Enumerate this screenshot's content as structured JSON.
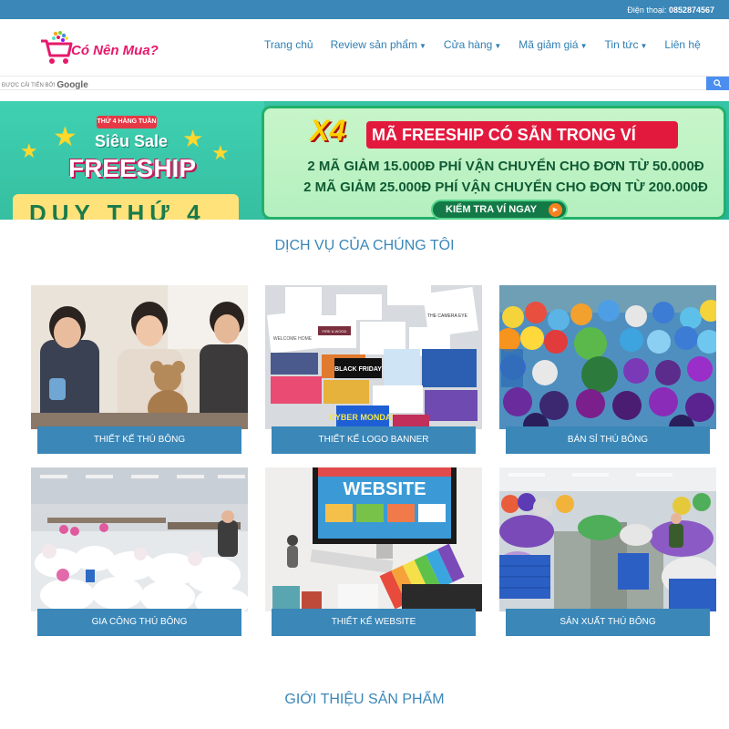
{
  "topbar": {
    "phone_label": "Điện thoại:",
    "phone_number": "0852874567"
  },
  "logo": {
    "text": "Có Nên Mua?"
  },
  "nav": [
    {
      "label": "Trang chủ",
      "has_caret": false
    },
    {
      "label": "Review sản phẩm",
      "has_caret": true
    },
    {
      "label": "Cửa hàng",
      "has_caret": true
    },
    {
      "label": "Mã giảm giá",
      "has_caret": true
    },
    {
      "label": "Tin tức",
      "has_caret": true
    },
    {
      "label": "Liên hệ",
      "has_caret": false
    }
  ],
  "search": {
    "powered_by": "ĐƯỢC CẢI TIẾN BỞI",
    "google": "Google",
    "button_icon": "search-icon"
  },
  "banner": {
    "left_chip": "THỨ 4 HÀNG TUẦN",
    "left_line1": "Siêu Sale",
    "left_line2": "FREESHIP",
    "left_bottom": "DUY THỨ 4",
    "right_x4": "X4",
    "right_title": "MÃ FREESHIP CÓ SẴN TRONG VÍ",
    "right_line1": "2 MÃ GIẢM 15.000Đ PHÍ VẬN CHUYỂN CHO ĐƠN TỪ 50.000Đ",
    "right_line2": "2 MÃ GIẢM 25.000Đ PHÍ VẬN CHUYỂN CHO ĐƠN TỪ 200.000Đ",
    "right_cta": "KIỂM TRA VÍ NGAY"
  },
  "services": {
    "title": "DỊCH VỤ CỦA CHÚNG TÔI",
    "items": [
      {
        "label": "THIẾT KẾ THÚ BÔNG"
      },
      {
        "label": "THIẾT KẾ LOGO BANNER"
      },
      {
        "label": "BÁN SỈ THÚ BÔNG"
      },
      {
        "label": "GIA CÔNG THÚ BÔNG"
      },
      {
        "label": "THIẾT KẾ WEBSITE"
      },
      {
        "label": "SẢN XUẤT THÚ BÔNG"
      }
    ]
  },
  "image_text": {
    "website": "WEBSITE",
    "black_friday": "BLACK FRIDAY",
    "cyber_monday": "CYBER MONDAY",
    "camera_eye": "THE CAMERA EYE",
    "welcome": "WELCOME HOME",
    "fire_wood": "FIRE & WOOD"
  },
  "products": {
    "title": "GIỚI THIỆU SẢN PHẨM"
  },
  "colors": {
    "primary": "#3a87b8",
    "logo": "#e6196b",
    "banner_green": "#22b06b",
    "banner_red": "#e2193d"
  }
}
